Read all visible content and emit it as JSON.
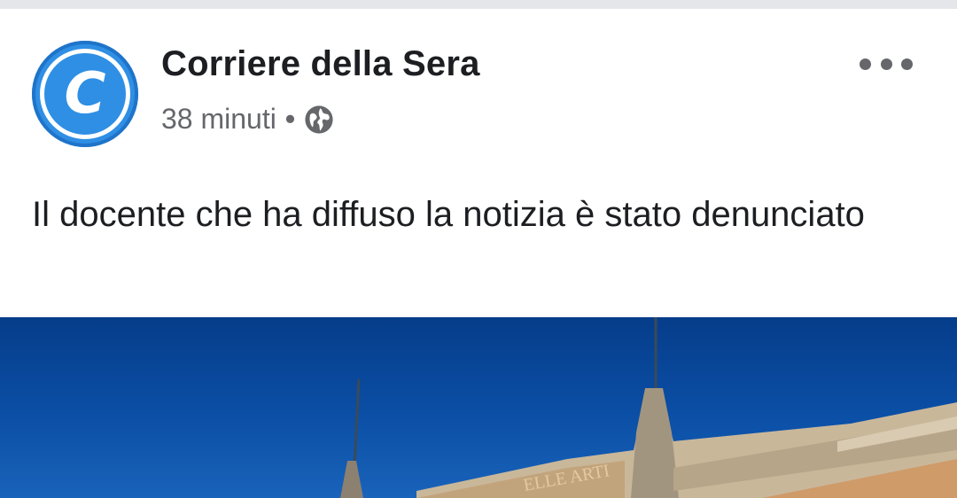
{
  "post": {
    "page_name": "Corriere della Sera",
    "avatar_letter": "C",
    "timestamp": "38 minuti",
    "separator": "•",
    "audience_icon": "globe-icon",
    "more_icon": "more-options-icon",
    "text": "Il docente che ha diffuso la notizia è stato denunciato",
    "image_building_sign": "ELLE ARTI"
  },
  "colors": {
    "avatar_blue": "#2f8fe4",
    "sky_blue": "#0b4fa6",
    "text_primary": "#1c1e21",
    "text_secondary": "#65676b"
  }
}
